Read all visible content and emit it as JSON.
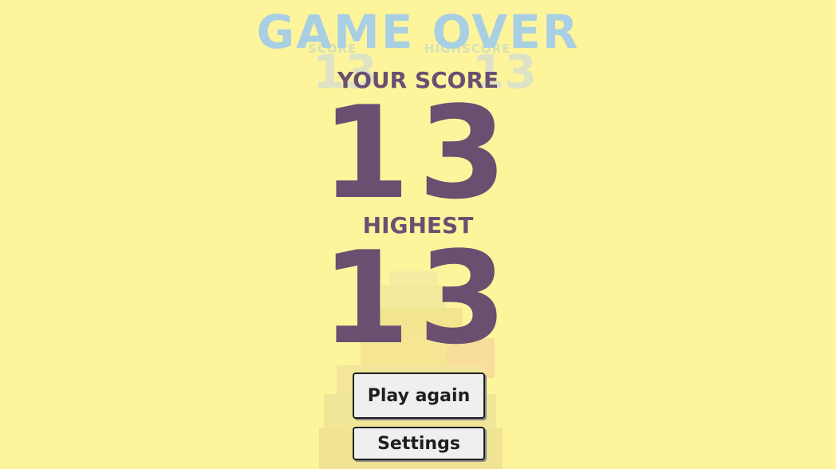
{
  "title": "GAME OVER",
  "background_color": "#fef49c",
  "accent_color": "#6a4f71",
  "title_color": "#a9cfe3",
  "score": {
    "label": "YOUR SCORE",
    "value": "13"
  },
  "highest": {
    "label": "HIGHEST",
    "value": "13"
  },
  "buttons": {
    "play_again": "Play again",
    "settings": "Settings"
  }
}
